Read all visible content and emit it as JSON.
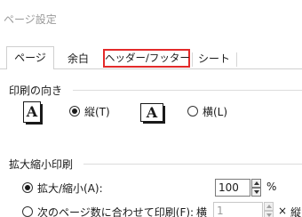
{
  "window": {
    "title": "ページ設定"
  },
  "tabs": [
    {
      "label": "ページ",
      "active": true
    },
    {
      "label": "余白",
      "active": false
    },
    {
      "label": "ヘッダー/フッター",
      "active": false,
      "highlighted": true
    },
    {
      "label": "シート",
      "active": false
    }
  ],
  "orientation": {
    "heading": "印刷の向き",
    "portrait_icon_letter": "A",
    "portrait_label": "縦(T)",
    "portrait_checked": true,
    "landscape_icon_letter": "A",
    "landscape_label": "横(L)",
    "landscape_checked": false
  },
  "scaling": {
    "heading": "拡大縮小印刷",
    "adjust_label": "拡大/縮小(A):",
    "adjust_checked": true,
    "adjust_value": "100",
    "adjust_unit": "%",
    "fit_label": "次のページ数に合わせて印刷(F):",
    "fit_checked": false,
    "fit_wide_label": "横",
    "fit_wide_value": "1",
    "fit_times": "×",
    "fit_tall_label": "縦"
  },
  "colors": {
    "highlight_border": "#e32a2a",
    "tab_border": "#cfcfcf",
    "title_text": "#9a9a9a"
  }
}
